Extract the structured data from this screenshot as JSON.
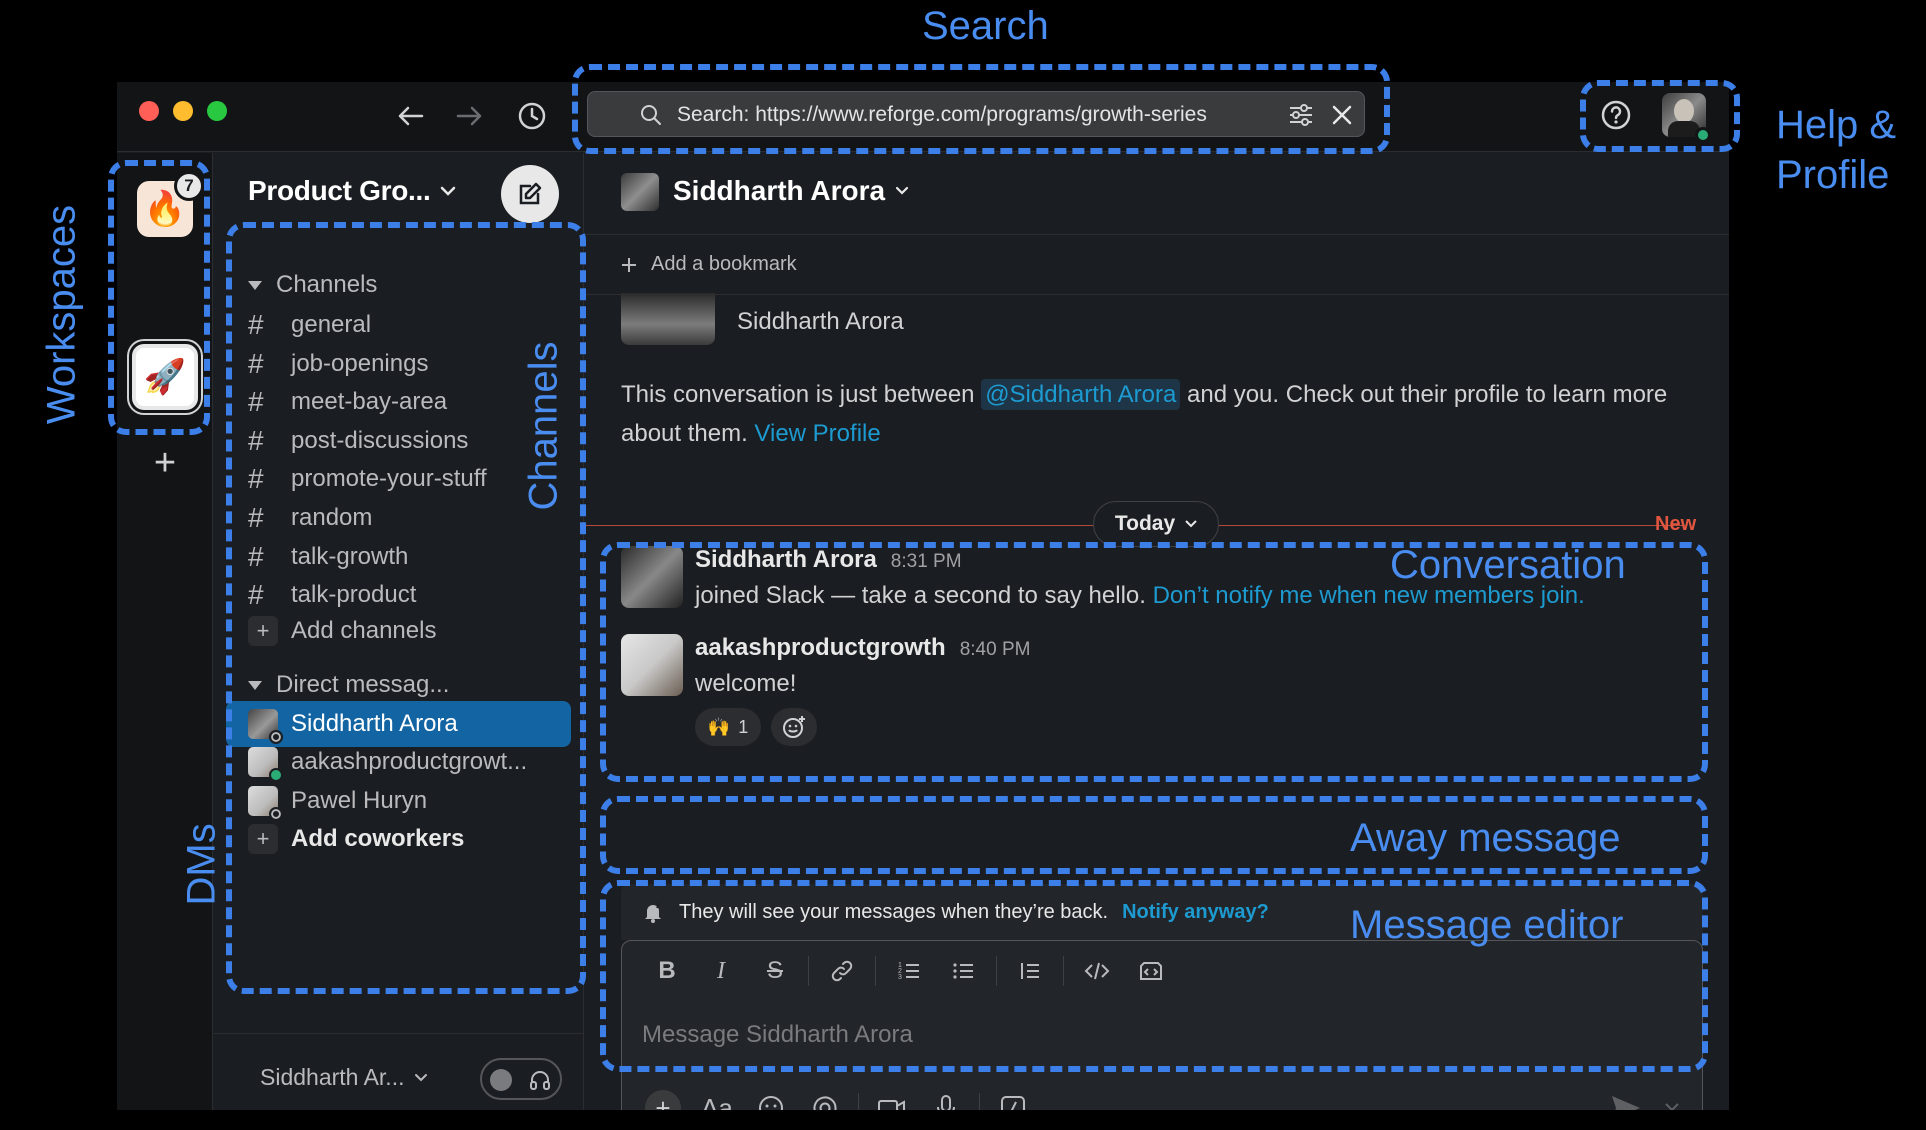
{
  "titlebar": {
    "search_text": "Search: https://www.reforge.com/programs/growth-series"
  },
  "workspaces": {
    "badge_count": "7",
    "add_label": "+"
  },
  "sidebar": {
    "workspace_name": "Product Gro...",
    "channels_header": "Channels",
    "channels": [
      "general",
      "job-openings",
      "meet-bay-area",
      "post-discussions",
      "promote-your-stuff",
      "random",
      "talk-growth",
      "talk-product"
    ],
    "add_channels": "Add channels",
    "dm_header": "Direct messag...",
    "dms": [
      {
        "name": "Siddharth Arora",
        "status": "away",
        "active": true
      },
      {
        "name": "aakashproductgrowt...",
        "status": "online",
        "active": false
      },
      {
        "name": "Pawel Huryn",
        "status": "away",
        "active": false
      }
    ],
    "add_coworkers": "Add coworkers",
    "footer_user": "Siddharth Ar..."
  },
  "main": {
    "title": "Siddharth Arora",
    "bookmark": "Add a bookmark",
    "intro_name": "Siddharth Arora",
    "intro_prefix": "This conversation is just between ",
    "intro_mention": "@Siddharth Arora",
    "intro_mid": " and you. Check out their profile to learn more about them. ",
    "intro_link": "View Profile",
    "day_label": "Today",
    "new_label": "New",
    "messages": [
      {
        "author": "Siddharth Arora",
        "time": "8:31 PM",
        "text": "joined Slack — take a second to say hello. ",
        "link": "Don’t notify me when new members join."
      },
      {
        "author": "aakashproductgrowth",
        "time": "8:40 PM",
        "text": "welcome!",
        "reaction_emoji": "🙌",
        "reaction_count": "1"
      }
    ],
    "away_text": "They will see your messages when they’re back.",
    "away_link": "Notify anyway?",
    "placeholder": "Message Siddharth Arora"
  },
  "annotations": {
    "search": "Search",
    "help_profile_1": "Help &",
    "help_profile_2": "Profile",
    "workspaces": "Workspaces",
    "channels": "Channels",
    "dms": "DMs",
    "conversation": "Conversation",
    "away": "Away message",
    "editor": "Message editor"
  },
  "colors": {
    "annotation": "#3d7fe8",
    "active_dm": "#1264a3",
    "link": "#1d9bd1",
    "new_divider": "#e0563f"
  }
}
